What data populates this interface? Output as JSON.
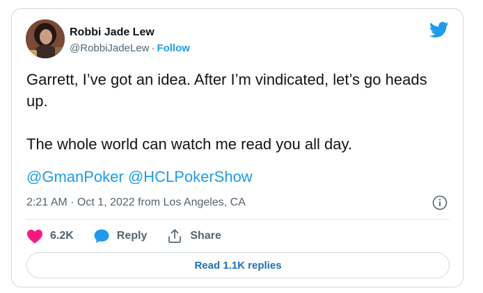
{
  "author": {
    "name": "Robbi Jade Lew",
    "handle": "@RobbiJadeLew",
    "separator": "·",
    "follow_label": "Follow"
  },
  "tweet": {
    "paragraphs": [
      "Garrett, I’ve got an idea. After I’m vindicated, let’s go heads up.",
      "The whole world can watch me read you all day."
    ],
    "mentions": [
      "@GmanPoker",
      "@HCLPokerShow"
    ],
    "timestamp": "2:21 AM · Oct 1, 2022 from Los Angeles, CA"
  },
  "actions": {
    "likes_count": "6.2K",
    "reply_label": "Reply",
    "share_label": "Share"
  },
  "replies_button_label": "Read 1.1K replies",
  "colors": {
    "accent": "#1d9bf0",
    "heart": "#f91880",
    "muted": "#536471",
    "text": "#0f1419"
  },
  "icons": [
    "twitter-bird-icon",
    "info-icon",
    "heart-icon",
    "reply-bubble-icon",
    "share-icon"
  ]
}
